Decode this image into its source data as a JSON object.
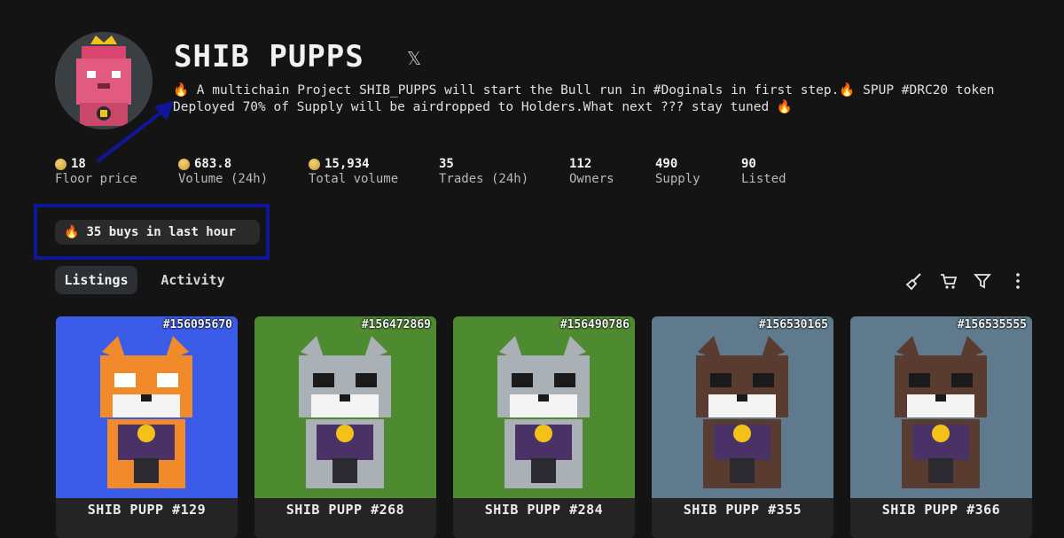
{
  "collection": {
    "title": "SHIB PUPPS",
    "social_icon": "x-icon",
    "description": "🔥 A multichain Project SHIB_PUPPS will start the Bull run in #Doginals in first step.🔥 SPUP #DRC20 token Deployed 70% of Supply will be airdropped to Holders.What next ??? stay tuned 🔥"
  },
  "stats": [
    {
      "value": "18",
      "label": "Floor price",
      "coin": true
    },
    {
      "value": "683.8",
      "label": "Volume (24h)",
      "coin": true
    },
    {
      "value": "15,934",
      "label": "Total volume",
      "coin": true
    },
    {
      "value": "35",
      "label": "Trades (24h)",
      "coin": false
    },
    {
      "value": "112",
      "label": "Owners",
      "coin": false
    },
    {
      "value": "490",
      "label": "Supply",
      "coin": false
    },
    {
      "value": "90",
      "label": "Listed",
      "coin": false
    }
  ],
  "activity_pill": {
    "icon": "fire-icon",
    "text": "35 buys in last hour"
  },
  "tabs": [
    {
      "label": "Listings",
      "active": true
    },
    {
      "label": "Activity",
      "active": false
    }
  ],
  "toolbar_icons": [
    "broom-icon",
    "cart-icon",
    "filter-icon",
    "more-vertical-icon"
  ],
  "listings": [
    {
      "inscription": "#156095670",
      "name": "SHIB PUPP  #129",
      "bg": "#3a5ce8"
    },
    {
      "inscription": "#156472869",
      "name": "SHIB PUPP  #268",
      "bg": "#4e8a2f"
    },
    {
      "inscription": "#156490786",
      "name": "SHIB PUPP  #284",
      "bg": "#4e8a2f"
    },
    {
      "inscription": "#156530165",
      "name": "SHIB PUPP  #355",
      "bg": "#5e7a8c"
    },
    {
      "inscription": "#156535555",
      "name": "SHIB PUPP  #366",
      "bg": "#5e7a8c"
    }
  ],
  "colors": {
    "accent": "#10169a",
    "coin": "#d8ad4a",
    "fire": "#ff7a1a"
  }
}
